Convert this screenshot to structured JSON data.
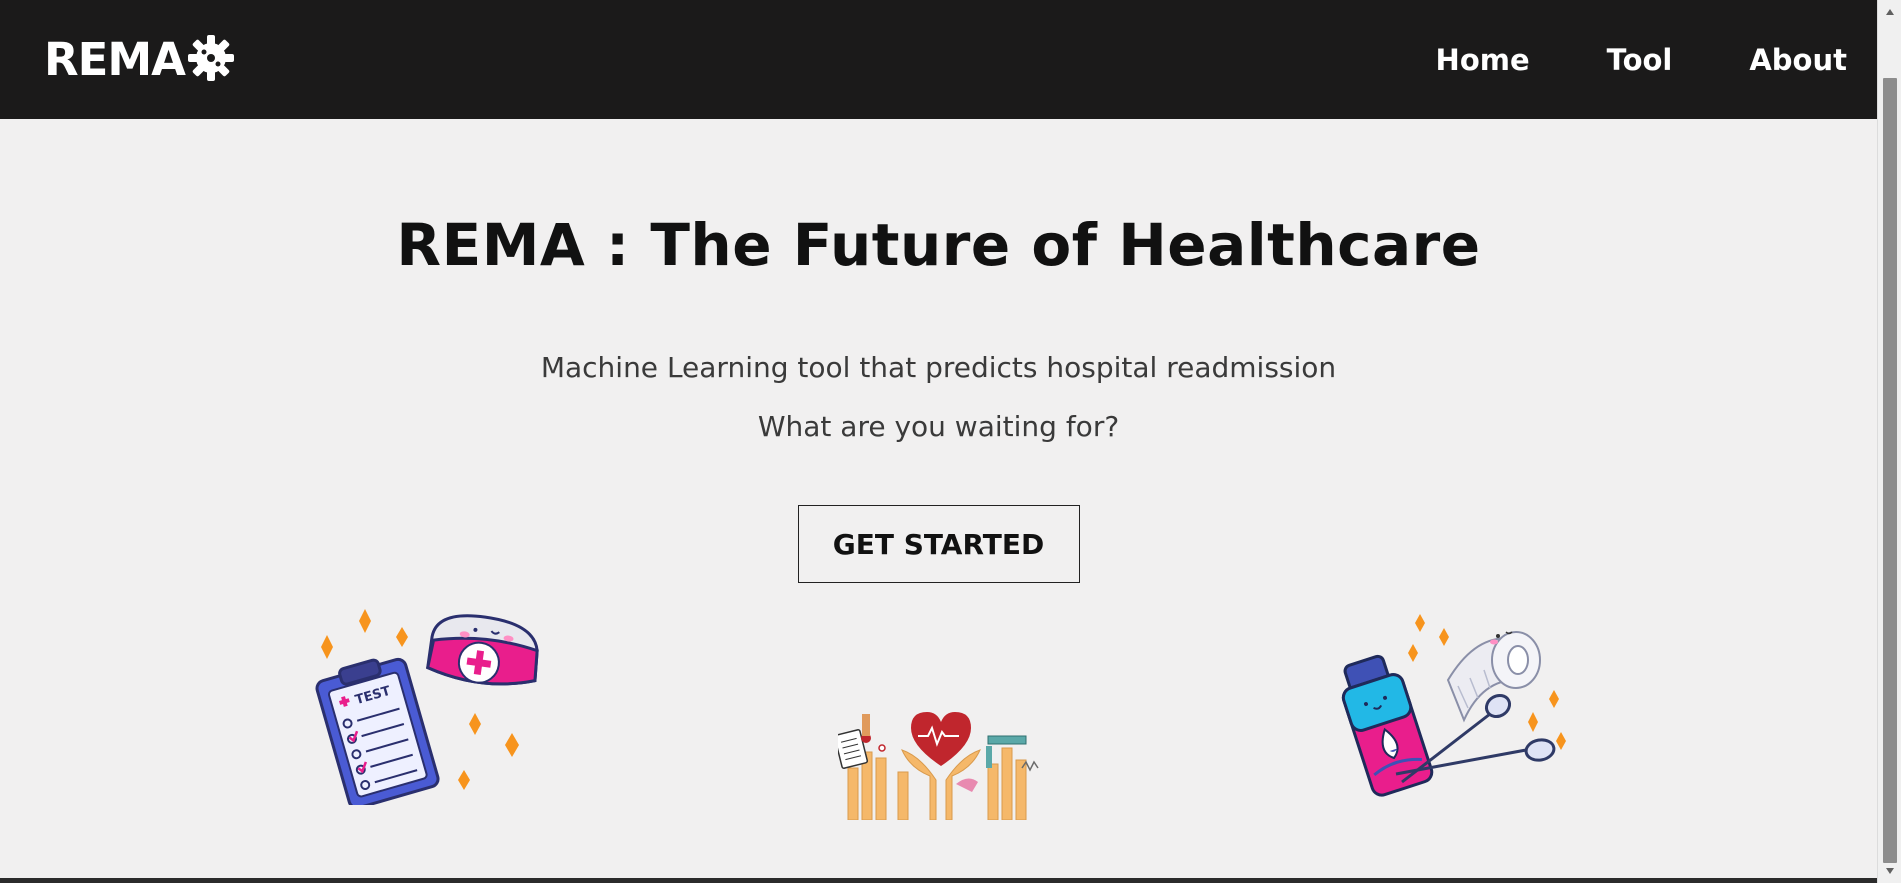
{
  "nav": {
    "brand": "REMA",
    "brand_icon": "gear-icon",
    "links": [
      "Home",
      "Tool",
      "About"
    ]
  },
  "hero": {
    "title": "REMA : The Future of Healthcare",
    "subtitle": "Machine Learning tool that predicts hospital readmission",
    "subtitle2": "What are you waiting for?",
    "cta_label": "GET STARTED"
  },
  "illustrations": {
    "left_test_label": "TEST",
    "left": "clipboard-and-nurse-cap-icon",
    "center": "hands-holding-heart-icon",
    "right": "bottle-bandage-scissors-icon"
  },
  "colors": {
    "navbar": "#1b1a1a",
    "background": "#f1f0f0",
    "accent_pink": "#e91e8c",
    "accent_orange": "#f7941d"
  }
}
